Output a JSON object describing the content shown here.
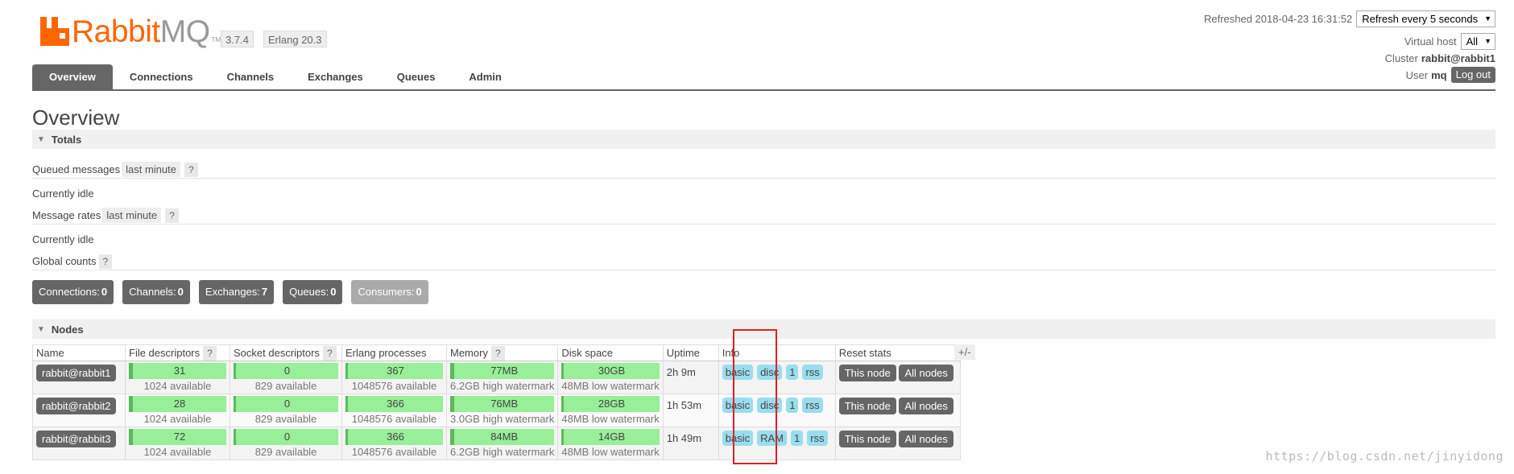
{
  "brand": {
    "rabbit": "Rabbit",
    "mq": "MQ",
    "tm": "TM"
  },
  "versions": {
    "rabbitmq": "3.7.4",
    "erlang": "Erlang 20.3"
  },
  "header": {
    "refreshed_label": "Refreshed 2018-04-23 16:31:52",
    "refresh_select": "Refresh every 5 seconds",
    "vhost_label": "Virtual host",
    "vhost_select": "All",
    "cluster_label": "Cluster",
    "cluster_name": "rabbit@rabbit1",
    "user_label": "User",
    "user_name": "mq",
    "logout": "Log out"
  },
  "tabs": [
    "Overview",
    "Connections",
    "Channels",
    "Exchanges",
    "Queues",
    "Admin"
  ],
  "page_title": "Overview",
  "totals": {
    "title": "Totals",
    "queued_label": "Queued messages",
    "queued_range": "last minute",
    "help": "?",
    "idle1": "Currently idle",
    "rates_label": "Message rates",
    "rates_range": "last minute",
    "idle2": "Currently idle",
    "global_label": "Global counts"
  },
  "counters": [
    {
      "label": "Connections:",
      "value": "0"
    },
    {
      "label": "Channels:",
      "value": "0"
    },
    {
      "label": "Exchanges:",
      "value": "7"
    },
    {
      "label": "Queues:",
      "value": "0"
    },
    {
      "label": "Consumers:",
      "value": "0"
    }
  ],
  "nodes": {
    "title": "Nodes",
    "columns": [
      "Name",
      "File descriptors",
      "Socket descriptors",
      "Erlang processes",
      "Memory",
      "Disk space",
      "Uptime",
      "Info",
      "Reset stats"
    ],
    "help": "?",
    "toggle": "+/-",
    "this_node": "This node",
    "all_nodes": "All nodes",
    "rows": [
      {
        "name": "rabbit@rabbit1",
        "fd": "31",
        "fd_sub": "1024 available",
        "sock": "0",
        "sock_sub": "829 available",
        "proc": "367",
        "proc_sub": "1048576 available",
        "mem": "77MB",
        "mem_sub": "6.2GB high watermark",
        "disk": "30GB",
        "disk_sub": "48MB low watermark",
        "uptime": "2h 9m",
        "info": [
          "basic",
          "disc",
          "1",
          "rss"
        ]
      },
      {
        "name": "rabbit@rabbit2",
        "fd": "28",
        "fd_sub": "1024 available",
        "sock": "0",
        "sock_sub": "829 available",
        "proc": "366",
        "proc_sub": "1048576 available",
        "mem": "76MB",
        "mem_sub": "3.0GB high watermark",
        "disk": "28GB",
        "disk_sub": "48MB low watermark",
        "uptime": "1h 53m",
        "info": [
          "basic",
          "disc",
          "1",
          "rss"
        ]
      },
      {
        "name": "rabbit@rabbit3",
        "fd": "72",
        "fd_sub": "1024 available",
        "sock": "0",
        "sock_sub": "829 available",
        "proc": "366",
        "proc_sub": "1048576 available",
        "mem": "84MB",
        "mem_sub": "6.2GB high watermark",
        "disk": "14GB",
        "disk_sub": "48MB low watermark",
        "uptime": "1h 49m",
        "info": [
          "basic",
          "RAM",
          "1",
          "rss"
        ]
      }
    ]
  },
  "watermark": "https://blog.csdn.net/jinyidong",
  "colors": {
    "brand_orange": "#ff6600",
    "bar_green": "#99ee99",
    "info_blue": "#99ddee",
    "highlight_red": "#e02020"
  }
}
